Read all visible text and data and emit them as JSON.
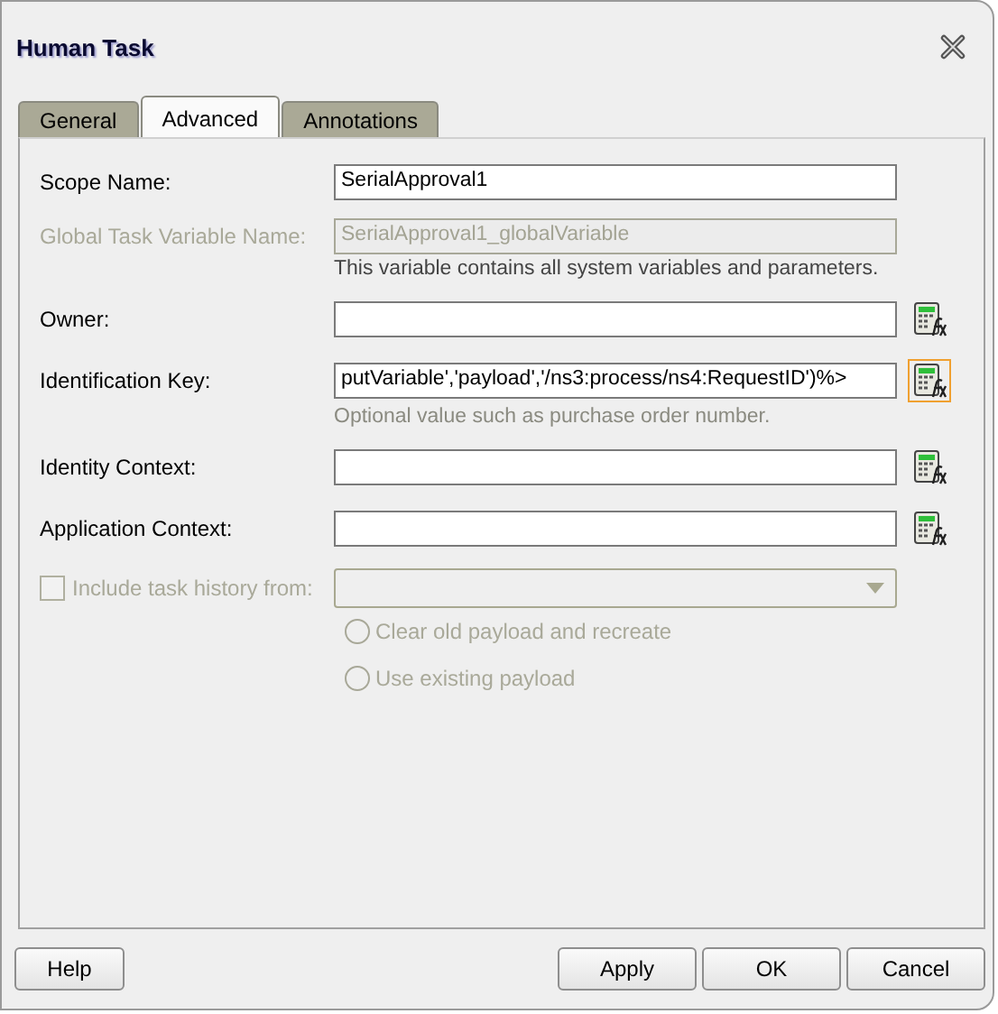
{
  "window": {
    "title": "Human Task"
  },
  "tabs": [
    {
      "label": "General",
      "selected": false
    },
    {
      "label": "Advanced",
      "selected": true
    },
    {
      "label": "Annotations",
      "selected": false
    }
  ],
  "fields": [
    {
      "label": "Scope Name:",
      "value": "SerialApproval1",
      "disabled": false,
      "expression_button": false
    },
    {
      "label": "Global Task Variable Name:",
      "value": "SerialApproval1_globalVariable",
      "disabled": true,
      "expression_button": false,
      "hint": "This variable contains all system variables and parameters."
    },
    {
      "label": "Owner:",
      "disabled": false,
      "expression_button": true,
      "button_highlighted": false
    },
    {
      "label": "Identification Key:",
      "value": "putVariable','payload','/ns3:process/ns4:RequestID')%>",
      "disabled": false,
      "expression_button": true,
      "button_highlighted": true,
      "hint": "Optional value such as purchase order number."
    },
    {
      "label": "Identity Context:",
      "disabled": false,
      "expression_button": true,
      "button_highlighted": false
    },
    {
      "label": "Application Context:",
      "disabled": false,
      "expression_button": true,
      "button_highlighted": false
    }
  ],
  "history": {
    "label": "Include task history from:",
    "checked": false,
    "disabled": true,
    "options": [
      {
        "label": "Clear old payload and recreate",
        "selected": false
      },
      {
        "label": "Use existing payload",
        "selected": false
      }
    ]
  },
  "buttons_left": [
    "Help"
  ],
  "buttons_right": [
    "Apply",
    "OK",
    "Cancel"
  ]
}
